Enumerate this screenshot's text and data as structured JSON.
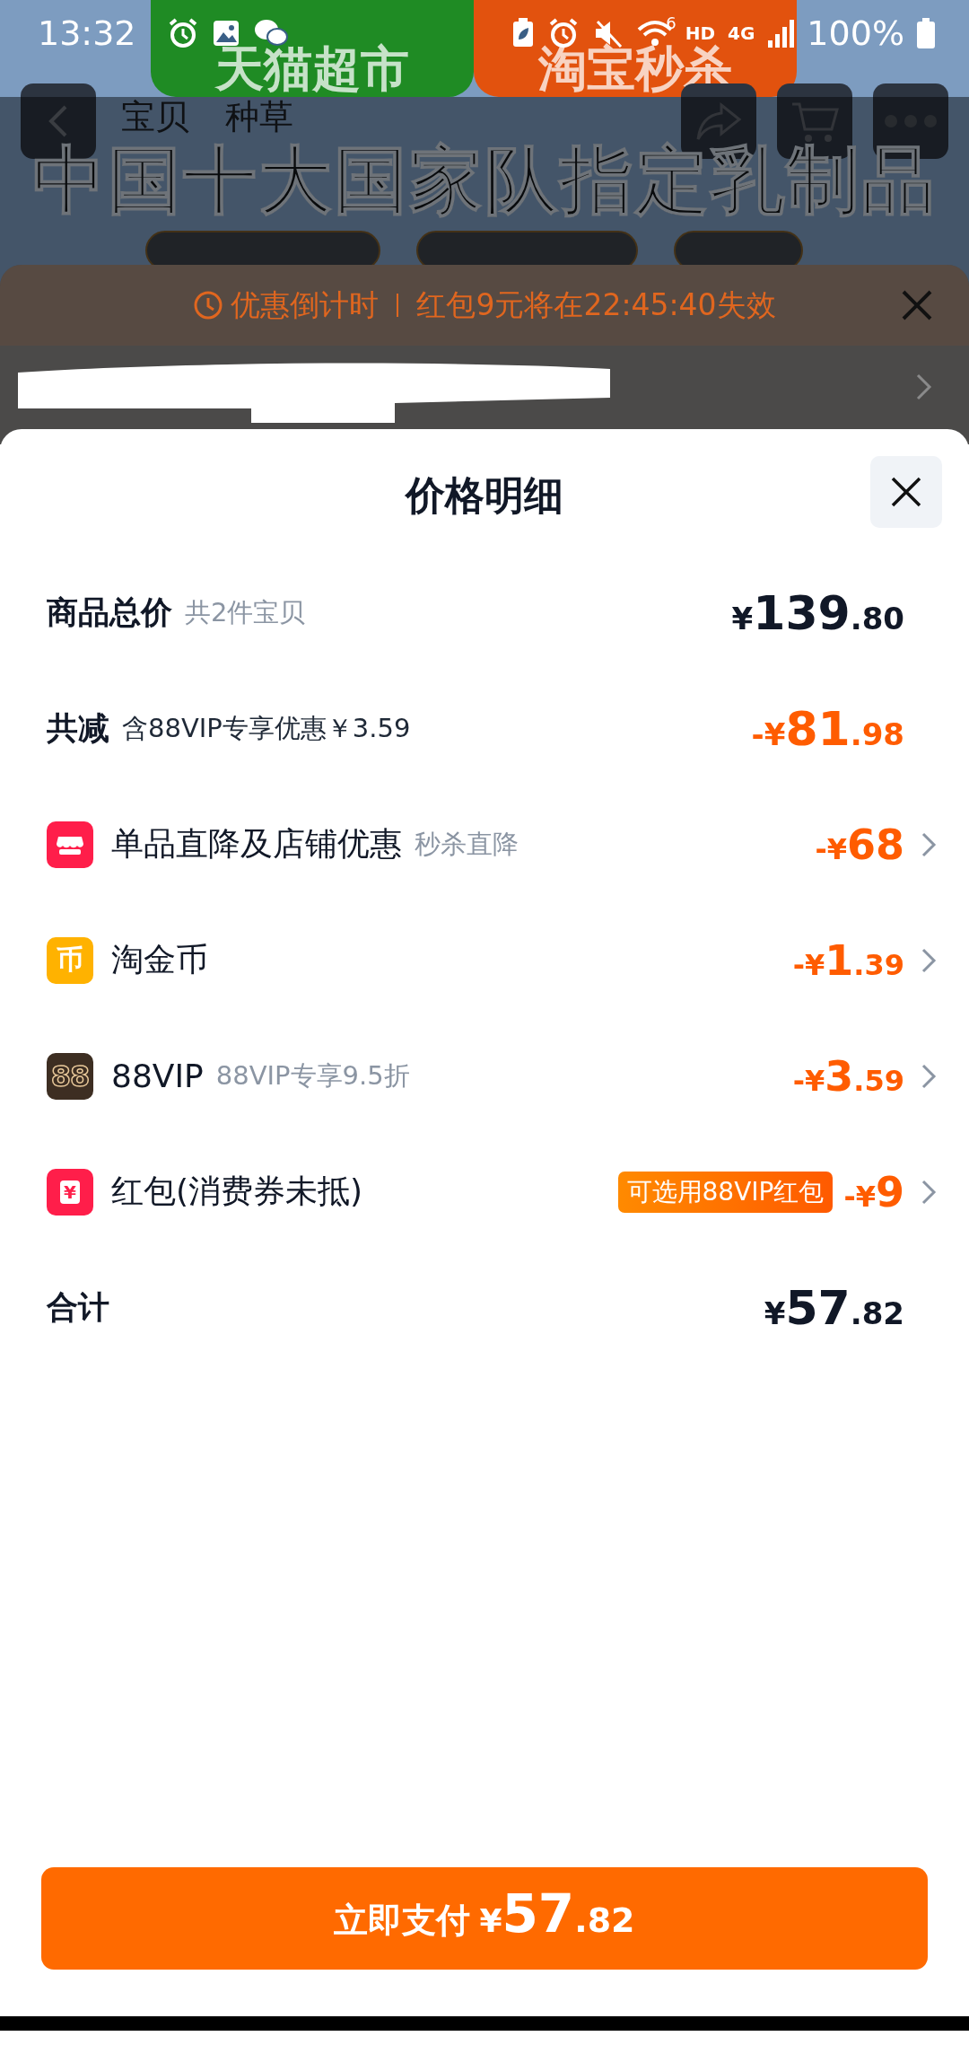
{
  "status_bar": {
    "time": "13:32",
    "wifi_badge": "6",
    "hd": "HD",
    "network": "4G",
    "battery": "100%"
  },
  "background_page": {
    "banners": [
      {
        "text": "天猫超市",
        "color": "#1f8b24"
      },
      {
        "text": "淘宝秒杀",
        "color": "#e2520e"
      }
    ],
    "tabs": [
      "宝贝",
      "种草"
    ],
    "headline": "中国十大国家队指定乳制品"
  },
  "countdown_sheet": {
    "label": "优惠倒计时",
    "message": "红包9元将在22:45:40失效"
  },
  "price_sheet": {
    "title": "价格明细",
    "rows": [
      {
        "kind": "summary",
        "label": "商品总价",
        "note": "共2件宝贝",
        "note_muted": true,
        "amount": {
          "prefix": "¥",
          "integer": "139",
          "decimal": ".80"
        },
        "negative": false,
        "chevron": false
      },
      {
        "kind": "summary",
        "label": "共减",
        "note": "含88VIP专享优惠￥3.59",
        "note_muted": false,
        "amount": {
          "prefix": "-¥",
          "integer": "81",
          "decimal": ".98"
        },
        "negative": true,
        "chevron": false
      },
      {
        "kind": "store",
        "label": "单品直降及店铺优惠",
        "note": "秒杀直降",
        "note_muted": true,
        "amount": {
          "prefix": "-¥",
          "integer": "68"
        },
        "negative": true,
        "chevron": true
      },
      {
        "kind": "coin",
        "icon_text": "币",
        "label": "淘金币",
        "amount": {
          "prefix": "-¥",
          "integer": "1",
          "decimal": ".39"
        },
        "negative": true,
        "chevron": true
      },
      {
        "kind": "vip",
        "icon_text": "88",
        "label": "88VIP",
        "note": "88VIP专享9.5折",
        "note_muted": true,
        "amount": {
          "prefix": "-¥",
          "integer": "3",
          "decimal": ".59"
        },
        "negative": true,
        "chevron": true
      },
      {
        "kind": "packet",
        "icon_text": "¥",
        "label": "红包(消费券未抵)",
        "tag": "可选用88VIP红包",
        "amount": {
          "prefix": "-¥",
          "integer": "9"
        },
        "negative": true,
        "chevron": true
      },
      {
        "kind": "summary",
        "label": "合计",
        "amount": {
          "prefix": "¥",
          "integer": "57",
          "decimal": ".82"
        },
        "negative": false,
        "chevron": false
      }
    ]
  },
  "pay_button": {
    "label": "立即支付",
    "amount": {
      "prefix": "¥",
      "integer": "57",
      "decimal": ".82"
    }
  }
}
